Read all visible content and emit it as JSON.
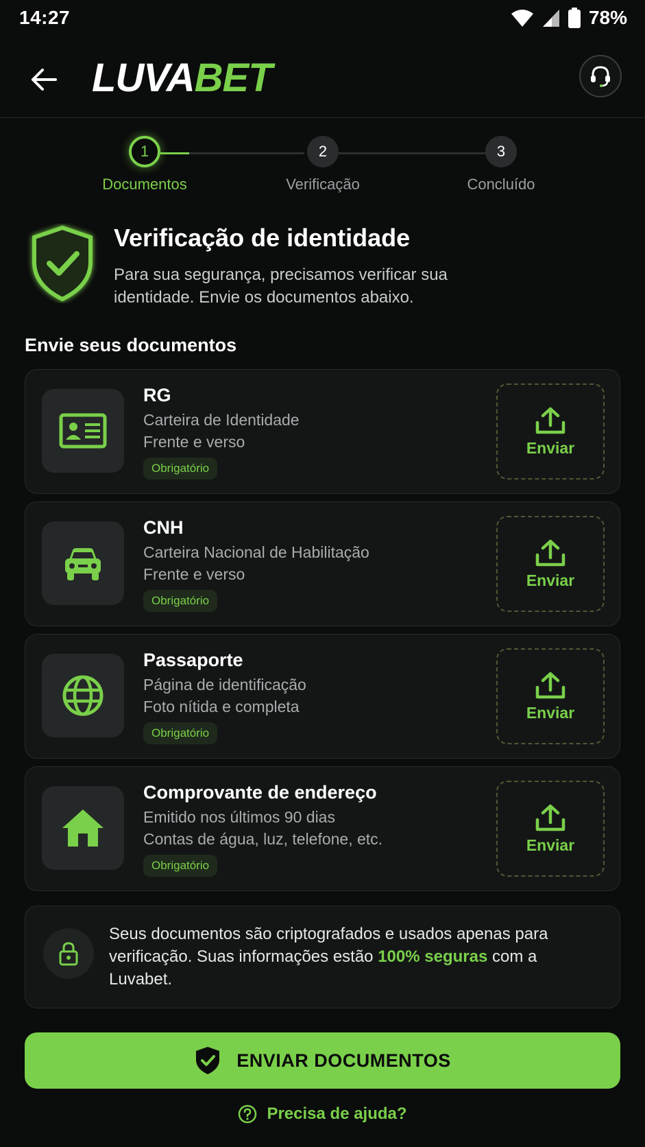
{
  "status_bar": {
    "time": "14:27",
    "battery": "78%"
  },
  "header": {
    "logo_part1": "LUVA",
    "logo_part2": "BET"
  },
  "stepper": {
    "steps": [
      {
        "number": "1",
        "label": "Documentos"
      },
      {
        "number": "2",
        "label": "Verificação"
      },
      {
        "number": "3",
        "label": "Concluído"
      }
    ]
  },
  "intro": {
    "title": "Verificação de identidade",
    "description": "Para sua segurança, precisamos verificar sua identidade. Envie os documentos abaixo."
  },
  "section_title": "Envie seus documentos",
  "documents": [
    {
      "title": "RG",
      "line1": "Carteira de Identidade",
      "line2": "Frente e verso",
      "badge": "Obrigatório",
      "upload_label": "Enviar",
      "icon": "id-card-icon"
    },
    {
      "title": "CNH",
      "line1": "Carteira Nacional de Habilitação",
      "line2": "Frente e verso",
      "badge": "Obrigatório",
      "upload_label": "Enviar",
      "icon": "car-icon"
    },
    {
      "title": "Passaporte",
      "line1": "Página de identificação",
      "line2": "Foto nítida e completa",
      "badge": "Obrigatório",
      "upload_label": "Enviar",
      "icon": "globe-icon"
    },
    {
      "title": "Comprovante de endereço",
      "line1": "Emitido nos últimos 90 dias",
      "line2": "Contas de água, luz, telefone, etc.",
      "badge": "Obrigatório",
      "upload_label": "Enviar",
      "icon": "home-icon"
    }
  ],
  "security": {
    "text_before": "Seus documentos são criptografados e usados apenas para verificação. Suas informações estão ",
    "highlight": "100% seguras",
    "text_after": " com a Luvabet."
  },
  "cta": {
    "label": "ENVIAR DOCUMENTOS"
  },
  "help": {
    "label": "Precisa de ajuda?"
  },
  "colors": {
    "accent": "#7ad04a",
    "background": "#0b0c0c",
    "card": "#141616"
  }
}
